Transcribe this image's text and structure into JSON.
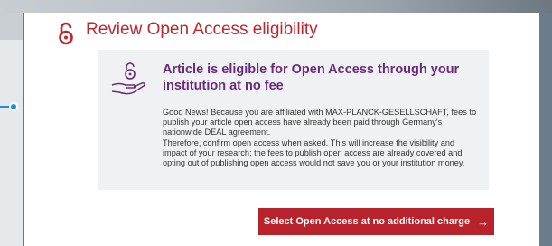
{
  "header": {
    "title": "Review Open Access eligibility",
    "icon": "open-lock-icon",
    "accent_color": "#c0262d"
  },
  "eligibility": {
    "icon": "hand-lock-icon",
    "heading": "Article is eligible for Open Access through your institution at no fee",
    "body_1": "Good News! Because you are affiliated with MAX-PLANCK-GESELLSCHAFT, fees to publish your article open access have already been paid through Germany's nationwide DEAL agreement.",
    "body_2": "Therefore, confirm open access when asked. This will increase the visibility and impact of your research; the fees to publish open access are already covered and opting out of publishing open access would not save you or your institution money.",
    "heading_color": "#6a2a7a"
  },
  "actions": {
    "select_label": "Select Open Access at no additional charge",
    "arrow": "→",
    "arrow_icon": "arrow-right-icon",
    "button_color": "#b8232b"
  }
}
